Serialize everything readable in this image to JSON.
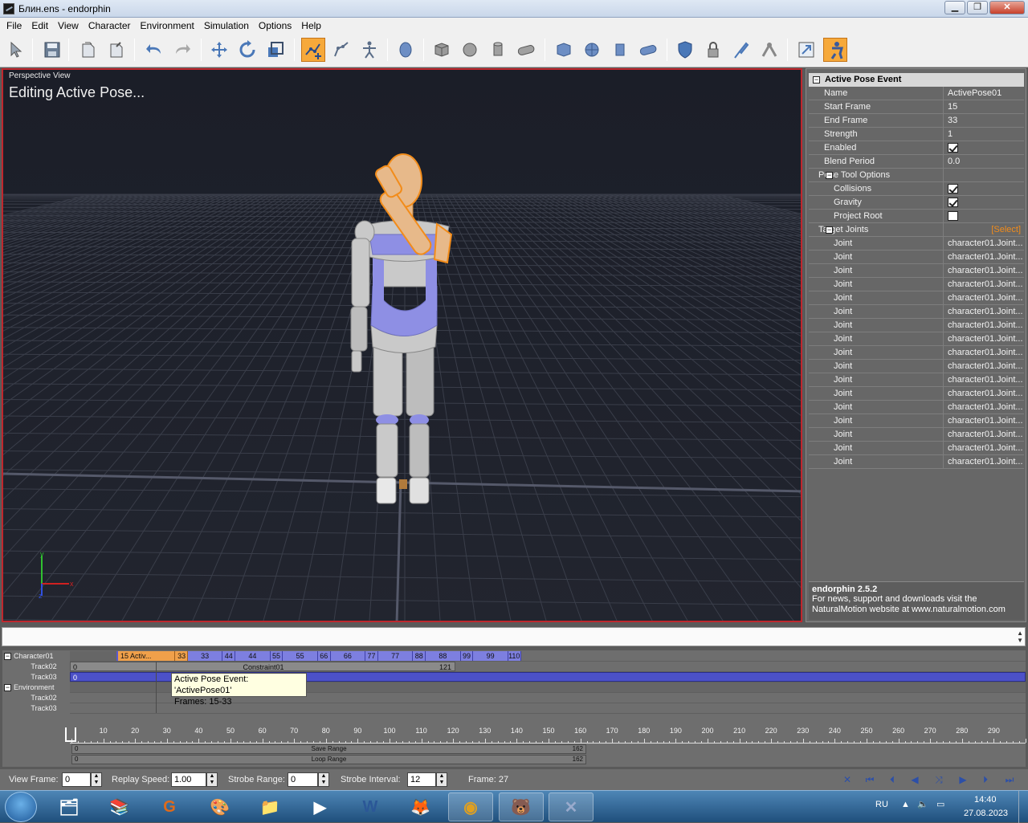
{
  "window": {
    "title": "Блин.ens - endorphin",
    "minimize": "▁",
    "maximize": "❐",
    "close": "✕"
  },
  "menu": [
    "File",
    "Edit",
    "View",
    "Character",
    "Environment",
    "Simulation",
    "Options",
    "Help"
  ],
  "toolbar": {
    "buttons": [
      "select-tool-icon",
      "save-icon",
      "open-document-icon",
      "new-document-icon",
      "undo-icon",
      "redo-icon",
      "move-icon",
      "rotate-icon",
      "scale-icon",
      "active-pose-icon",
      "pose-chain-icon",
      "character-pose-icon",
      "head-icon",
      "box-icon",
      "sphere-icon",
      "cylinder-icon",
      "capsule-icon",
      "static-box-icon",
      "static-sphere-icon",
      "static-cylinder-icon",
      "static-capsule-icon",
      "shield-icon",
      "lock-icon",
      "pin-icon",
      "joint-tool-icon",
      "export-icon",
      "character-tool-icon"
    ],
    "active": [
      "active-pose-icon",
      "character-tool-icon"
    ]
  },
  "viewport": {
    "label": "Perspective View",
    "status": "Editing Active Pose..."
  },
  "panel": {
    "title": "Active Pose Event",
    "properties": [
      {
        "name": "Name",
        "value": "ActivePose01"
      },
      {
        "name": "Start Frame",
        "value": "15"
      },
      {
        "name": "End Frame",
        "value": "33"
      },
      {
        "name": "Strength",
        "value": "1"
      },
      {
        "name": "Enabled",
        "checked": true
      },
      {
        "name": "Blend Period",
        "value": "0.0"
      }
    ],
    "pose_tool_options": {
      "label": "Pose Tool Options",
      "items": [
        {
          "name": "Collisions",
          "checked": true
        },
        {
          "name": "Gravity",
          "checked": true
        },
        {
          "name": "Project Root",
          "checked": false
        }
      ]
    },
    "target_joints": {
      "label": "Target Joints",
      "select_link": "[Select]",
      "joint_label": "Joint",
      "joint_value": "character01.Joint...",
      "count": 17
    },
    "footer": {
      "version": "endorphin 2.5.2",
      "info": "For news, support and downloads visit the NaturalMotion website at www.naturalmotion.com"
    }
  },
  "timeline": {
    "tracks": [
      {
        "label": "Character01",
        "type": "group"
      },
      {
        "label": "Track02",
        "type": "track"
      },
      {
        "label": "Track03",
        "type": "track"
      },
      {
        "label": "Environment",
        "type": "group"
      },
      {
        "label": "Track02",
        "type": "track"
      },
      {
        "label": "Track03",
        "type": "track"
      }
    ],
    "character_events": [
      "15 Activ...",
      "33",
      "33",
      "44",
      "44",
      "55",
      "55",
      "66",
      "66",
      "77",
      "77",
      "88",
      "88",
      "99",
      "99",
      "110"
    ],
    "track02": {
      "start": "0",
      "label": "Constraint01",
      "end": "121"
    },
    "track03": {
      "start": "0"
    },
    "tooltip": {
      "line1": "Active Pose Event: 'ActivePose01'",
      "line2": "Frames: 15-33"
    },
    "ruler": [
      "10",
      "20",
      "30",
      "40",
      "50",
      "60",
      "70",
      "80",
      "90",
      "100",
      "110",
      "120",
      "130",
      "140",
      "150",
      "160",
      "170",
      "180",
      "190",
      "200",
      "210",
      "220",
      "230",
      "240",
      "250",
      "260",
      "270",
      "280",
      "290"
    ],
    "save_range": {
      "start": "0",
      "label": "Save Range",
      "end": "162"
    },
    "loop_range": {
      "start": "0",
      "label": "Loop Range",
      "end": "162"
    }
  },
  "controls": {
    "view_frame_label": "View Frame:",
    "view_frame": "0",
    "replay_speed_label": "Replay Speed:",
    "replay_speed": "1.00",
    "strobe_range_label": "Strobe Range:",
    "strobe_range": "0",
    "strobe_interval_label": "Strobe Interval:",
    "strobe_interval": "12",
    "frame_label": "Frame: 27"
  },
  "taskbar": {
    "apps": [
      "file-manager-icon",
      "winrar-icon",
      "g-app-icon",
      "paint-icon",
      "explorer-folder-icon",
      "media-player-icon",
      "word-icon",
      "firefox-icon",
      "chrome-icon",
      "green-app-icon",
      "endorphin-icon"
    ],
    "lang": "RU",
    "time": "14:40",
    "date": "27.08.2023"
  }
}
